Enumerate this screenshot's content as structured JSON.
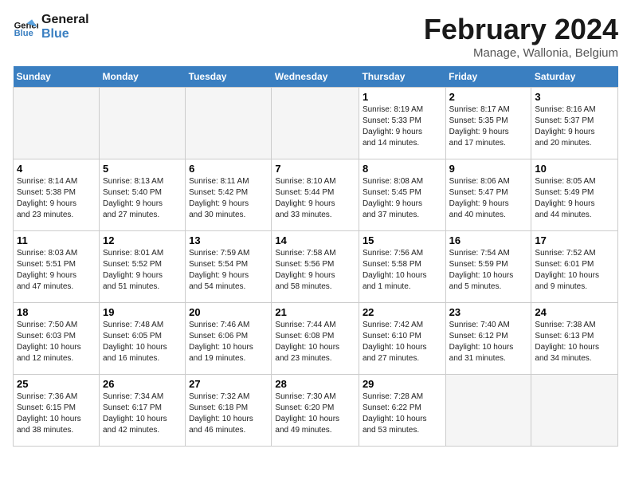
{
  "logo": {
    "line1": "General",
    "line2": "Blue"
  },
  "title": "February 2024",
  "subtitle": "Manage, Wallonia, Belgium",
  "days_header": [
    "Sunday",
    "Monday",
    "Tuesday",
    "Wednesday",
    "Thursday",
    "Friday",
    "Saturday"
  ],
  "weeks": [
    [
      {
        "day": "",
        "info": ""
      },
      {
        "day": "",
        "info": ""
      },
      {
        "day": "",
        "info": ""
      },
      {
        "day": "",
        "info": ""
      },
      {
        "day": "1",
        "info": "Sunrise: 8:19 AM\nSunset: 5:33 PM\nDaylight: 9 hours\nand 14 minutes."
      },
      {
        "day": "2",
        "info": "Sunrise: 8:17 AM\nSunset: 5:35 PM\nDaylight: 9 hours\nand 17 minutes."
      },
      {
        "day": "3",
        "info": "Sunrise: 8:16 AM\nSunset: 5:37 PM\nDaylight: 9 hours\nand 20 minutes."
      }
    ],
    [
      {
        "day": "4",
        "info": "Sunrise: 8:14 AM\nSunset: 5:38 PM\nDaylight: 9 hours\nand 23 minutes."
      },
      {
        "day": "5",
        "info": "Sunrise: 8:13 AM\nSunset: 5:40 PM\nDaylight: 9 hours\nand 27 minutes."
      },
      {
        "day": "6",
        "info": "Sunrise: 8:11 AM\nSunset: 5:42 PM\nDaylight: 9 hours\nand 30 minutes."
      },
      {
        "day": "7",
        "info": "Sunrise: 8:10 AM\nSunset: 5:44 PM\nDaylight: 9 hours\nand 33 minutes."
      },
      {
        "day": "8",
        "info": "Sunrise: 8:08 AM\nSunset: 5:45 PM\nDaylight: 9 hours\nand 37 minutes."
      },
      {
        "day": "9",
        "info": "Sunrise: 8:06 AM\nSunset: 5:47 PM\nDaylight: 9 hours\nand 40 minutes."
      },
      {
        "day": "10",
        "info": "Sunrise: 8:05 AM\nSunset: 5:49 PM\nDaylight: 9 hours\nand 44 minutes."
      }
    ],
    [
      {
        "day": "11",
        "info": "Sunrise: 8:03 AM\nSunset: 5:51 PM\nDaylight: 9 hours\nand 47 minutes."
      },
      {
        "day": "12",
        "info": "Sunrise: 8:01 AM\nSunset: 5:52 PM\nDaylight: 9 hours\nand 51 minutes."
      },
      {
        "day": "13",
        "info": "Sunrise: 7:59 AM\nSunset: 5:54 PM\nDaylight: 9 hours\nand 54 minutes."
      },
      {
        "day": "14",
        "info": "Sunrise: 7:58 AM\nSunset: 5:56 PM\nDaylight: 9 hours\nand 58 minutes."
      },
      {
        "day": "15",
        "info": "Sunrise: 7:56 AM\nSunset: 5:58 PM\nDaylight: 10 hours\nand 1 minute."
      },
      {
        "day": "16",
        "info": "Sunrise: 7:54 AM\nSunset: 5:59 PM\nDaylight: 10 hours\nand 5 minutes."
      },
      {
        "day": "17",
        "info": "Sunrise: 7:52 AM\nSunset: 6:01 PM\nDaylight: 10 hours\nand 9 minutes."
      }
    ],
    [
      {
        "day": "18",
        "info": "Sunrise: 7:50 AM\nSunset: 6:03 PM\nDaylight: 10 hours\nand 12 minutes."
      },
      {
        "day": "19",
        "info": "Sunrise: 7:48 AM\nSunset: 6:05 PM\nDaylight: 10 hours\nand 16 minutes."
      },
      {
        "day": "20",
        "info": "Sunrise: 7:46 AM\nSunset: 6:06 PM\nDaylight: 10 hours\nand 19 minutes."
      },
      {
        "day": "21",
        "info": "Sunrise: 7:44 AM\nSunset: 6:08 PM\nDaylight: 10 hours\nand 23 minutes."
      },
      {
        "day": "22",
        "info": "Sunrise: 7:42 AM\nSunset: 6:10 PM\nDaylight: 10 hours\nand 27 minutes."
      },
      {
        "day": "23",
        "info": "Sunrise: 7:40 AM\nSunset: 6:12 PM\nDaylight: 10 hours\nand 31 minutes."
      },
      {
        "day": "24",
        "info": "Sunrise: 7:38 AM\nSunset: 6:13 PM\nDaylight: 10 hours\nand 34 minutes."
      }
    ],
    [
      {
        "day": "25",
        "info": "Sunrise: 7:36 AM\nSunset: 6:15 PM\nDaylight: 10 hours\nand 38 minutes."
      },
      {
        "day": "26",
        "info": "Sunrise: 7:34 AM\nSunset: 6:17 PM\nDaylight: 10 hours\nand 42 minutes."
      },
      {
        "day": "27",
        "info": "Sunrise: 7:32 AM\nSunset: 6:18 PM\nDaylight: 10 hours\nand 46 minutes."
      },
      {
        "day": "28",
        "info": "Sunrise: 7:30 AM\nSunset: 6:20 PM\nDaylight: 10 hours\nand 49 minutes."
      },
      {
        "day": "29",
        "info": "Sunrise: 7:28 AM\nSunset: 6:22 PM\nDaylight: 10 hours\nand 53 minutes."
      },
      {
        "day": "",
        "info": ""
      },
      {
        "day": "",
        "info": ""
      }
    ]
  ]
}
